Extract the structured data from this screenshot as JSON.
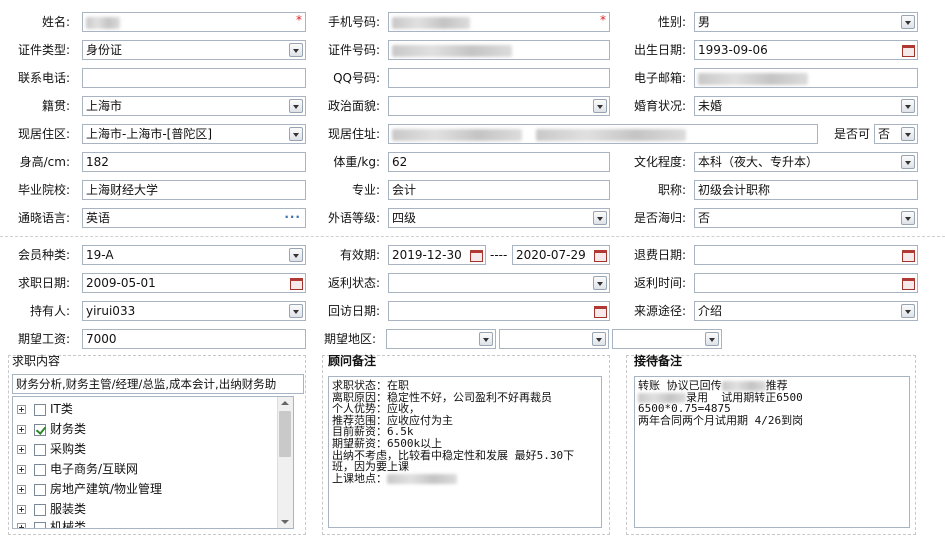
{
  "labels": {
    "name": "姓名:",
    "mobile": "手机号码:",
    "gender": "性别:",
    "id_type": "证件类型:",
    "id_number": "证件号码:",
    "birth_date": "出生日期:",
    "phone": "联系电话:",
    "qq": "QQ号码:",
    "email": "电子邮箱:",
    "native_place": "籍贯:",
    "political": "政治面貌:",
    "marital": "婚育状况:",
    "residence_area": "现居住区:",
    "residence_address": "现居住址:",
    "is_ok": "是否可",
    "height": "身高/cm:",
    "weight": "体重/kg:",
    "education": "文化程度:",
    "school": "毕业院校:",
    "major": "专业:",
    "title": "职称:",
    "language": "通晓语言:",
    "foreign_level": "外语等级:",
    "overseas": "是否海归:",
    "member_type": "会员种类:",
    "valid_period": "有效期:",
    "period_sep": "----",
    "refund_date": "退费日期:",
    "job_date": "求职日期:",
    "rebate_status": "返利状态:",
    "rebate_time": "返利时间:",
    "holder": "持有人:",
    "visit_date": "回访日期:",
    "source": "来源途径:",
    "expected_salary": "期望工资:",
    "expected_region": "期望地区:",
    "job_content": "求职内容"
  },
  "values": {
    "gender": "男",
    "id_type": "身份证",
    "birth_date": "1993-09-06",
    "native_place": "上海市",
    "marital": "未婚",
    "residence_area": "上海市-上海市-[普陀区]",
    "is_ok": "否",
    "height": "182",
    "weight": "62",
    "education": "本科（夜大、专升本）",
    "school": "上海财经大学",
    "major": "会计",
    "title": "初级会计职称",
    "language": "英语",
    "foreign_level": "四级",
    "overseas": "否",
    "member_type": "19-A",
    "valid_from": "2019-12-30",
    "valid_to": "2020-07-29",
    "job_date": "2009-05-01",
    "holder": "yirui033",
    "source": "介绍",
    "expected_salary": "7000",
    "job_content_summary": "财务分析,财务主管/经理/总监,成本会计,出纳财务助"
  },
  "required_mark": "*",
  "more_dots": "···",
  "tree": {
    "items": [
      {
        "label": "IT类",
        "checked": false
      },
      {
        "label": "财务类",
        "checked": true
      },
      {
        "label": "采购类",
        "checked": false
      },
      {
        "label": "电子商务/互联网",
        "checked": false
      },
      {
        "label": "房地产建筑/物业管理",
        "checked": false
      },
      {
        "label": "服装类",
        "checked": false
      },
      {
        "label": "机械类",
        "checked": false
      }
    ]
  },
  "consultant": {
    "title": "顾问备注",
    "lines": [
      "求职状态：在职",
      "离职原因：稳定性不好，公司盈利不好再裁员",
      "个人优势：应收，",
      "推荐范围：应收应付为主",
      "目前薪资：6.5k",
      "期望薪资：6500k以上",
      "出纳不考虑，比较看中稳定性和发展 最好5.30下",
      "班，因为要上课",
      "上课地点："
    ]
  },
  "reception": {
    "title": "接待备注",
    "line1": "转账 协议已回传",
    "line1b": "推荐",
    "line2": "录用  试用期转正6500",
    "line3": "6500*0.75=4875",
    "line4": "两年合同两个月试用期 4/26到岗"
  },
  "colors": {
    "border": "#a9b4c2",
    "required": "#e02020",
    "check": "#2a8a2a"
  }
}
